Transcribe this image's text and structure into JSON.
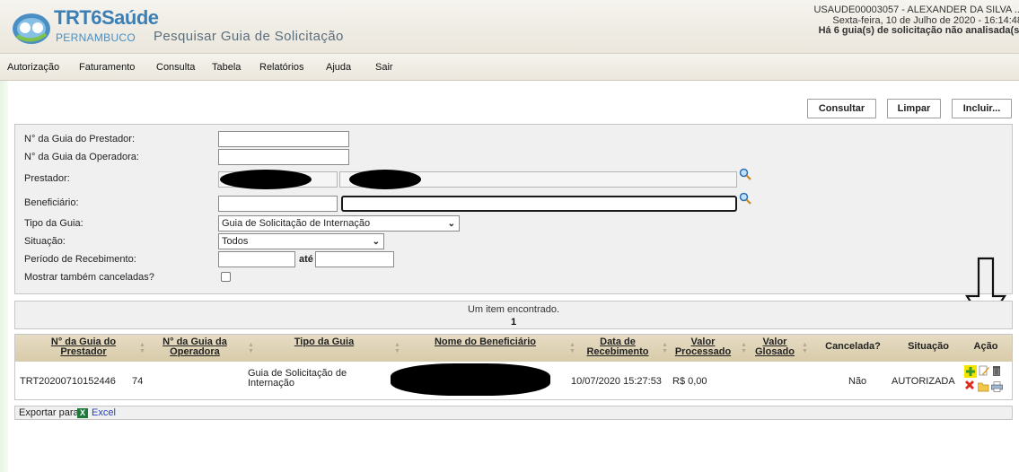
{
  "app": {
    "logo_title": "TRT6Saúde",
    "logo_subtitle": "PERNAMBUCO",
    "page_title": "Pesquisar Guia de Solicitação"
  },
  "user": {
    "line1": "USAUDE00003057 - ALEXANDER DA SILVA ...",
    "line2": "Sexta-feira, 10 de Julho de 2020 - 16:14:48",
    "line3": "Há 6 guia(s) de solicitação não analisada(s)"
  },
  "menu": [
    "Autorização",
    "Faturamento",
    "Consulta",
    "Tabela",
    "Relatórios",
    "Ajuda",
    "Sair"
  ],
  "actions": {
    "consultar": "Consultar",
    "limpar": "Limpar",
    "incluir": "Incluir..."
  },
  "form": {
    "guia_prestador_label": "N° da Guia do Prestador:",
    "guia_prestador_value": "",
    "guia_operadora_label": "N° da Guia da Operadora:",
    "guia_operadora_value": "",
    "prestador_label": "Prestador:",
    "beneficiario_label": "Beneficiário:",
    "beneficiario_value": "",
    "tipo_label": "Tipo da Guia:",
    "tipo_value": "Guia de Solicitação de Internação",
    "situacao_label": "Situação:",
    "situacao_value": "Todos",
    "periodo_label": "Período de Recebimento:",
    "periodo_ate": "até",
    "periodo_inicio": "",
    "periodo_fim": "",
    "canceladas_label": "Mostrar também canceladas?",
    "canceladas_checked": false
  },
  "results": {
    "message": "Um item encontrado.",
    "page": "1"
  },
  "table": {
    "headers": {
      "guia_prestador": "N° da Guia do Prestador",
      "guia_operadora": "N° da Guia da Operadora",
      "tipo": "Tipo da Guia",
      "beneficiario": "Nome do Beneficiário",
      "data": "Data de Recebimento",
      "valor_processado": "Valor Processado",
      "valor_glosado": "Valor Glosado",
      "cancelada": "Cancelada?",
      "situacao": "Situação",
      "acao": "Ação"
    },
    "rows": [
      {
        "guia_prestador": "TRT20200710152446",
        "guia_operadora": "74",
        "tipo": "Guia de Solicitação de Internação",
        "data": "10/07/2020 15:27:53",
        "valor_processado": "R$ 0,00",
        "valor_glosado": "",
        "cancelada": "Não",
        "situacao": "AUTORIZADA"
      }
    ]
  },
  "export": {
    "label": "Exportar para:",
    "excel": "Excel"
  },
  "icons": [
    "logo-icon",
    "search-icon",
    "add-icon",
    "edit-icon",
    "delete-icon",
    "cancel-icon",
    "folder-icon",
    "print-icon",
    "excel-icon",
    "down-arrow-icon"
  ],
  "colors": {
    "header_bg": "#eae6dc",
    "table_header_bg": "#d8cba9",
    "link_blue": "#1f3fbf",
    "logo_blue": "#3b7fb5"
  }
}
